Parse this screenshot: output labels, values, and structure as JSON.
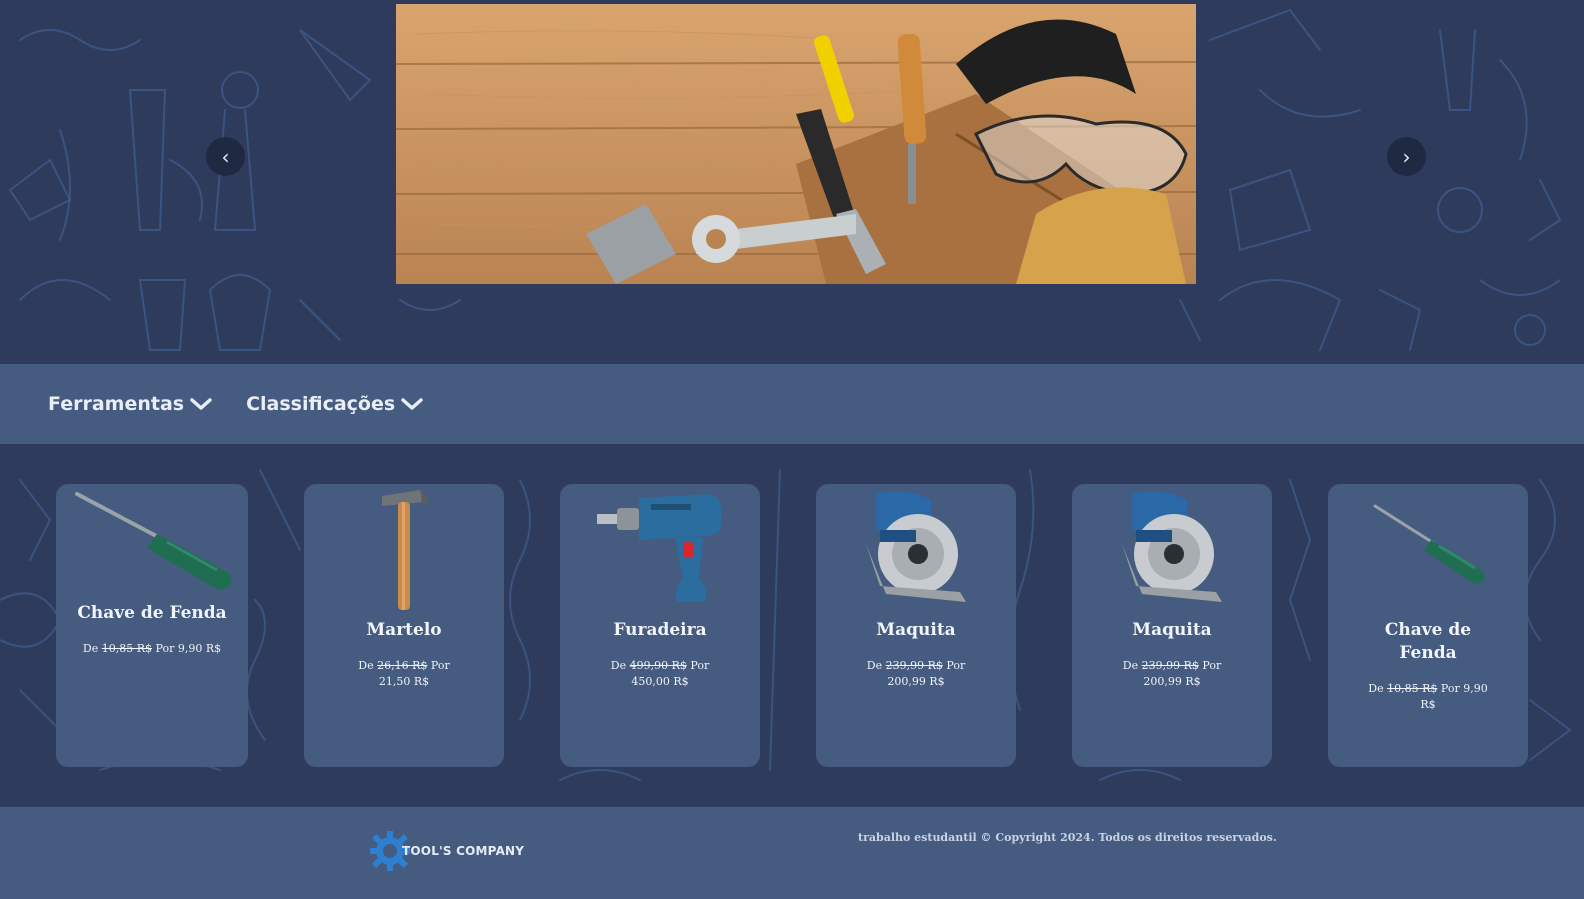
{
  "carousel": {
    "prev_label": "‹",
    "next_label": "›"
  },
  "nav": {
    "items": [
      {
        "label": "Ferramentas"
      },
      {
        "label": "Classificações"
      }
    ]
  },
  "products": [
    {
      "name": "Chave de Fenda",
      "price_prefix": "De",
      "old_price": "10,85 R$",
      "new_price_text": "Por 9,90 R$",
      "icon": "screwdriver-icon"
    },
    {
      "name": "Martelo",
      "price_prefix": "De",
      "old_price": "26,16 R$",
      "new_price_text": "Por 21,50 R$",
      "icon": "hammer-icon"
    },
    {
      "name": "Furadeira",
      "price_prefix": "De",
      "old_price": "499,90 R$",
      "new_price_text": "Por 450,00 R$",
      "icon": "drill-icon"
    },
    {
      "name": "Maquita",
      "price_prefix": "De",
      "old_price": "239,99 R$",
      "new_price_text": "Por 200,99 R$",
      "icon": "circular-saw-icon"
    },
    {
      "name": "Maquita",
      "price_prefix": "De",
      "old_price": "239,99 R$",
      "new_price_text": "Por 200,99 R$",
      "icon": "circular-saw-icon"
    },
    {
      "name": "Chave de Fenda",
      "price_prefix": "De",
      "old_price": "10,85 R$",
      "new_price_text": "Por 9,90 R$",
      "icon": "screwdriver-icon"
    }
  ],
  "footer": {
    "logo_text": "TOOL'S COMPANY",
    "copyright": "trabalho estudantil © Copyright 2024. Todos os direitos reservados."
  },
  "colors": {
    "background": "#2e3b5c",
    "panel": "#455b7f",
    "doodle": "#4a6aa3"
  }
}
